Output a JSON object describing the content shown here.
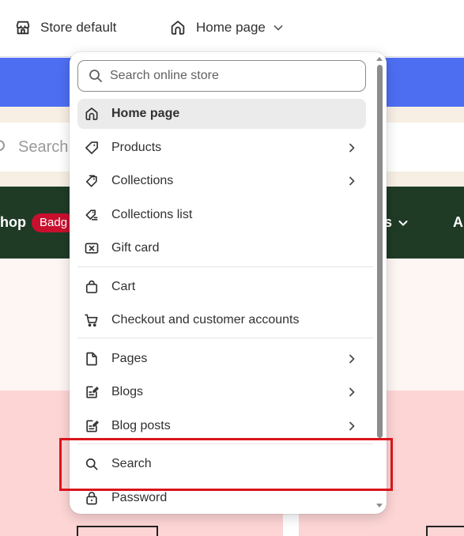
{
  "topbar": {
    "store_label": "Store default",
    "page_label": "Home page"
  },
  "background": {
    "search_placeholder": "Search",
    "shop_text": "hop",
    "badge_text": "Badg",
    "nav_fragment": "s",
    "nav_fragment_2": "A"
  },
  "dropdown": {
    "search_placeholder": "Search online store",
    "items": [
      {
        "label": "Home page",
        "icon": "home-icon",
        "selected": true,
        "has_arrow": false
      },
      {
        "label": "Products",
        "icon": "tag-icon",
        "selected": false,
        "has_arrow": true
      },
      {
        "label": "Collections",
        "icon": "collections-icon",
        "selected": false,
        "has_arrow": true
      },
      {
        "label": "Collections list",
        "icon": "collections-list-icon",
        "selected": false,
        "has_arrow": false
      },
      {
        "label": "Gift card",
        "icon": "gift-card-icon",
        "selected": false,
        "has_arrow": false
      },
      {
        "label": "Cart",
        "icon": "bag-icon",
        "selected": false,
        "has_arrow": false
      },
      {
        "label": "Checkout and customer accounts",
        "icon": "cart-icon",
        "selected": false,
        "has_arrow": false
      },
      {
        "label": "Pages",
        "icon": "page-icon",
        "selected": false,
        "has_arrow": true
      },
      {
        "label": "Blogs",
        "icon": "blog-icon",
        "selected": false,
        "has_arrow": true
      },
      {
        "label": "Blog posts",
        "icon": "blog-post-icon",
        "selected": false,
        "has_arrow": true
      },
      {
        "label": "Search",
        "icon": "search-icon",
        "selected": false,
        "has_arrow": false
      },
      {
        "label": "Password",
        "icon": "lock-icon",
        "selected": false,
        "has_arrow": false
      }
    ]
  },
  "colors": {
    "highlight": "#d9151b",
    "accent_blue": "#4e6ef2",
    "dark_green": "#1f3b26",
    "badge_red": "#c8102e"
  }
}
